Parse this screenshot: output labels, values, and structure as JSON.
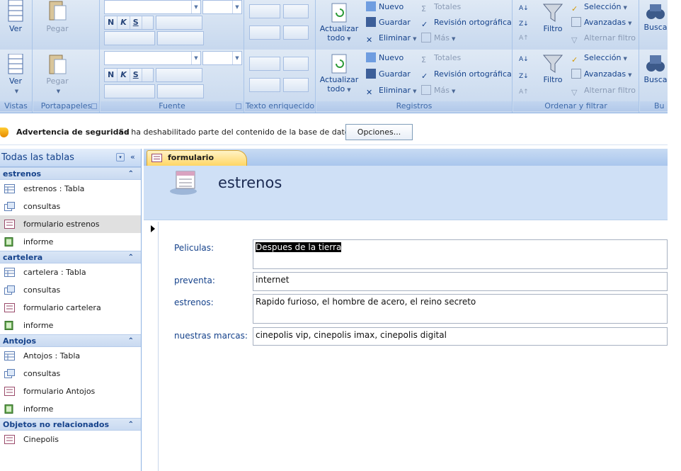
{
  "ribbon": {
    "view_label": "Ver",
    "paste_label": "Pegar",
    "refresh_label": "Actualizar",
    "refresh_label2": "todo",
    "new_label": "Nuevo",
    "save_label": "Guardar",
    "delete_label": "Eliminar",
    "totals_label": "Totales",
    "spelling_label": "Revisión ortográfica",
    "more_label": "Más",
    "filter_label": "Filtro",
    "selection_label": "Selección",
    "advanced_label": "Avanzadas",
    "toggle_filter_label": "Alternar filtro",
    "find_label": "Buscar",
    "find_label_cut": "Busca",
    "bold_label": "N",
    "italic_label": "K",
    "underline_label": "S",
    "groups": {
      "views": "Vistas",
      "clipboard": "Portapapeles",
      "font": "Fuente",
      "rich_text": "Texto enriquecido",
      "records": "Registros",
      "sort_filter": "Ordenar y filtrar",
      "find": "Bu"
    }
  },
  "security": {
    "title": "Advertencia de seguridad",
    "message": "Se ha deshabilitado parte del contenido de la base de datos",
    "options_label": "Opciones..."
  },
  "nav": {
    "header": "Todas las tablas",
    "dropdown_glyph": "▾",
    "collapse_glyph": "«",
    "chevron_glyph": "⌃",
    "groups": [
      {
        "name": "estrenos",
        "items": [
          {
            "label": "estrenos : Tabla",
            "type": "table"
          },
          {
            "label": "consultas",
            "type": "query"
          },
          {
            "label": "formulario estrenos",
            "type": "form"
          },
          {
            "label": "informe",
            "type": "report"
          }
        ]
      },
      {
        "name": "cartelera",
        "items": [
          {
            "label": "cartelera : Tabla",
            "type": "table"
          },
          {
            "label": "consultas",
            "type": "query"
          },
          {
            "label": "formulario cartelera",
            "type": "form"
          },
          {
            "label": "informe",
            "type": "report"
          }
        ]
      },
      {
        "name": "Antojos",
        "items": [
          {
            "label": "Antojos : Tabla",
            "type": "table"
          },
          {
            "label": "consultas",
            "type": "query"
          },
          {
            "label": "formulario Antojos",
            "type": "form"
          },
          {
            "label": "informe",
            "type": "report"
          }
        ]
      },
      {
        "name": "Objetos no relacionados",
        "items": [
          {
            "label": "Cinepolis",
            "type": "form"
          }
        ]
      }
    ]
  },
  "document": {
    "tab_label": "formulario estrenos",
    "form_title": "estrenos",
    "fields": [
      {
        "label": "Peliculas:",
        "value": "Despues de la tierra"
      },
      {
        "label": "preventa:",
        "value": "internet"
      },
      {
        "label": "estrenos:",
        "value": "Rapido  furioso, el hombre de acero, el reino secreto"
      },
      {
        "label": "nuestras marcas:",
        "value": "cinepolis vip, cinepolis imax, cinepolis digital"
      }
    ]
  },
  "colors": {
    "ribbon_bg": "#c7d8ee",
    "accent_blue": "#15428b",
    "active_tab": "#ffd665",
    "form_header": "#cfe0f6"
  }
}
